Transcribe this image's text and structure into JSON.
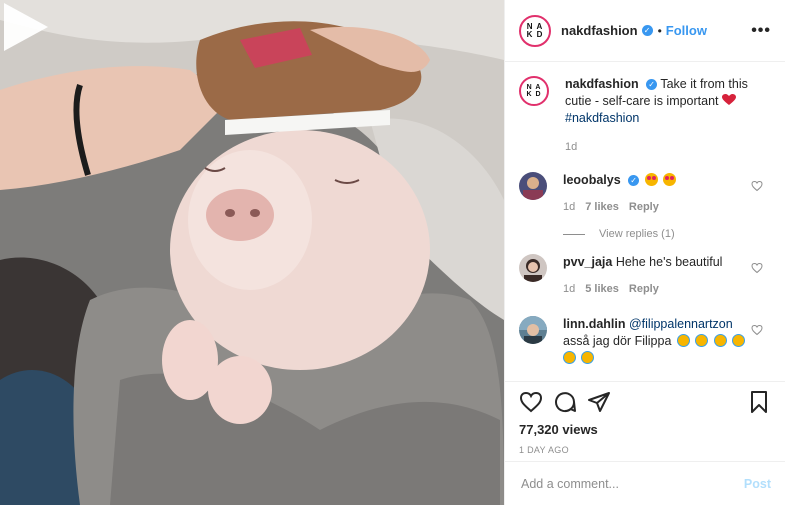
{
  "post": {
    "author": "nakdfashion",
    "follow_label": "Follow",
    "dot": "•",
    "more_label": "•••",
    "logo_text": "N A\nK D"
  },
  "caption": {
    "author": "nakdfashion",
    "text": "Take it from this cutie - self-care is important",
    "hashtag": "#nakdfashion",
    "age": "1d"
  },
  "comments": [
    {
      "user": "leoobalys",
      "verified": true,
      "text": "",
      "emojis": [
        "heart-eyes",
        "heart-eyes"
      ],
      "age": "1d",
      "likes": "7 likes",
      "reply": "Reply",
      "view_replies": "View replies (1)"
    },
    {
      "user": "pvv_jaja",
      "verified": false,
      "text": "Hehe he's beautiful",
      "age": "1d",
      "likes": "5 likes",
      "reply": "Reply"
    },
    {
      "user": "linn.dahlin",
      "verified": false,
      "mention": "@filippalennartzon",
      "text": "asså jag dör Filippa",
      "emojis": [
        "crying",
        "crying",
        "crying",
        "crying",
        "crying",
        "crying"
      ]
    }
  ],
  "stats": {
    "views": "77,320 views",
    "date": "1 DAY AGO"
  },
  "add_comment": {
    "placeholder": "Add a comment...",
    "post_label": "Post"
  },
  "icons": {
    "media": "play-icon",
    "actions": [
      "heart-icon",
      "comment-icon",
      "share-icon",
      "bookmark-icon"
    ]
  },
  "colors": {
    "link": "#3897f0",
    "verified": "#3897f0",
    "post_disabled": "#b2dffc",
    "ring": "#e1306c"
  }
}
